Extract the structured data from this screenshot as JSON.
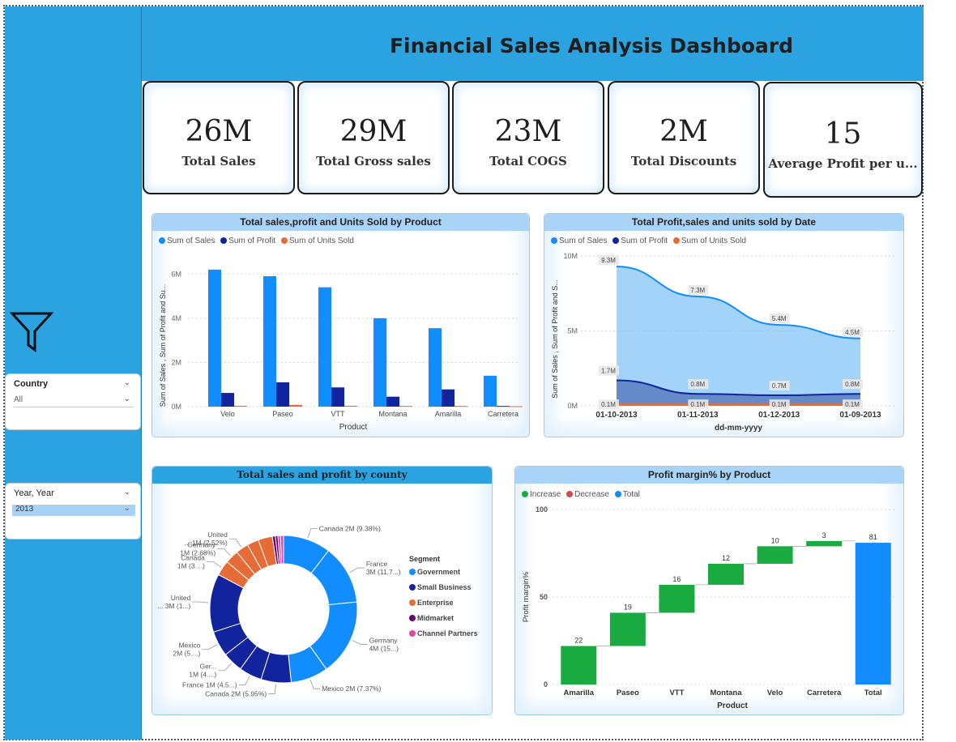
{
  "header": {
    "title": "Financial Sales Analysis Dashboard"
  },
  "filters": {
    "country": {
      "label": "Country",
      "value": "All"
    },
    "year": {
      "label": "Year, Year",
      "value": "2013"
    }
  },
  "kpis": [
    {
      "value": "26M",
      "label": "Total Sales"
    },
    {
      "value": "29M",
      "label": "Total Gross sales"
    },
    {
      "value": "23M",
      "label": "Total COGS"
    },
    {
      "value": "2M",
      "label": "Total Discounts"
    },
    {
      "value": "15",
      "label": "Average Profit per u..."
    }
  ],
  "colors": {
    "sales": "#118DFF",
    "profit": "#12239E",
    "units": "#E66C37",
    "midmarket": "#6B007B",
    "channel": "#E044A7",
    "increase": "#1AAB40",
    "decrease": "#D64550",
    "total": "#118DFF"
  },
  "chart_data": [
    {
      "type": "bar",
      "title": "Total sales,profit and Units Sold by Product",
      "xlabel": "Product",
      "ylabel": "Sum of Sales , Sum of Profit and Su...",
      "legend": [
        "Sum of   Sales",
        "Sum of  Profit",
        "Sum of Units Sold"
      ],
      "categories": [
        "Velo",
        "Paseo",
        "VTT",
        "Montana",
        "Amarilla",
        "Carretera"
      ],
      "series": [
        {
          "name": "Sum of   Sales",
          "values": [
            6.2,
            5.9,
            5.4,
            4.0,
            3.55,
            1.4
          ]
        },
        {
          "name": "Sum of  Profit",
          "values": [
            0.62,
            1.1,
            0.87,
            0.45,
            0.78,
            0.03
          ]
        },
        {
          "name": "Sum of Units Sold",
          "values": [
            0.04,
            0.08,
            0.04,
            0.03,
            0.03,
            0.02
          ]
        }
      ],
      "yticks": [
        "0M",
        "2M",
        "4M",
        "6M"
      ],
      "ylim": [
        0,
        7
      ]
    },
    {
      "type": "area",
      "title": "Total Profit,sales and units sold by Date",
      "xlabel": "dd-mm-yyyy",
      "ylabel": "Sum of Sales , Sum of Profit and S...",
      "legend": [
        "Sum of   Sales",
        "Sum of  Profit",
        "Sum of Units Sold"
      ],
      "x": [
        "01-10-2013",
        "01-11-2013",
        "01-12-2013",
        "01-09-2013"
      ],
      "series": [
        {
          "name": "Sum of   Sales",
          "values": [
            9.3,
            7.3,
            5.4,
            4.5
          ],
          "labels": [
            "9.3M",
            "7.3M",
            "5.4M",
            "4.5M"
          ]
        },
        {
          "name": "Sum of  Profit",
          "values": [
            1.7,
            0.8,
            0.7,
            0.8
          ],
          "labels": [
            "1.7M",
            "0.8M",
            "0.7M",
            "0.8M"
          ]
        },
        {
          "name": "Sum of Units Sold",
          "values": [
            0.1,
            0.1,
            0.1,
            0.1
          ],
          "labels": [
            "0.1M",
            "0.1M",
            "0.1M",
            "0.1M"
          ]
        }
      ],
      "yticks": [
        "0M",
        "5M",
        "10M"
      ],
      "ylim": [
        0,
        10
      ]
    },
    {
      "type": "pie",
      "title": "Total sales and profit by county",
      "legend_title": "Segment",
      "legend": [
        "Government",
        "Small Business",
        "Enterprise",
        "Midmarket",
        "Channel Partners"
      ],
      "slices": [
        {
          "segment": "Government",
          "value": 9.38,
          "label": "Canada 2M (9.38%)"
        },
        {
          "segment": "Government",
          "value": 11.7,
          "label": "France 3M (11.7...)"
        },
        {
          "segment": "Government",
          "value": 15.0,
          "label": "Germany 4M (15...)"
        },
        {
          "segment": "Government",
          "value": 7.37,
          "label": "Mexico 2M (7.37%)"
        },
        {
          "segment": "Small Business",
          "value": 5.95,
          "label": "Canada 2M (5.95%)"
        },
        {
          "segment": "Small Business",
          "value": 4.5,
          "label": "France 1M (4.5...)"
        },
        {
          "segment": "Small Business",
          "value": 4.0,
          "label": "Ger... 1M (4....)"
        },
        {
          "segment": "Small Business",
          "value": 5.0,
          "label": "Mexico 2M (5....)"
        },
        {
          "segment": "Small Business",
          "value": 11.5,
          "label": "United ... 3M (1...)"
        },
        {
          "segment": "Enterprise",
          "value": 3.0,
          "label": "Canada 1M (3....)"
        },
        {
          "segment": "Enterprise",
          "value": 2.68,
          "label": "Germany 1M (2.68%)"
        },
        {
          "segment": "Enterprise",
          "value": 2.52,
          "label": "United ... 1M (2.52%)"
        },
        {
          "segment": "Enterprise",
          "value": 2.3,
          "label": ""
        },
        {
          "segment": "Enterprise",
          "value": 2.8,
          "label": ""
        },
        {
          "segment": "Midmarket",
          "value": 0.6,
          "label": ""
        },
        {
          "segment": "Midmarket",
          "value": 0.5,
          "label": ""
        },
        {
          "segment": "Channel Partners",
          "value": 0.5,
          "label": ""
        },
        {
          "segment": "Channel Partners",
          "value": 0.6,
          "label": ""
        }
      ]
    },
    {
      "type": "bar",
      "title": "Profit margin% by Product",
      "xlabel": "Product",
      "ylabel": "Profit margin%",
      "legend": [
        "Increase",
        "Decrease",
        "Total"
      ],
      "categories": [
        "Amarilla",
        "Paseo",
        "VTT",
        "Montana",
        "Velo",
        "Carretera",
        "Total"
      ],
      "values": [
        22,
        19,
        16,
        12,
        10,
        3,
        81
      ],
      "yticks": [
        "0",
        "50",
        "100"
      ],
      "ylim": [
        0,
        100
      ]
    }
  ]
}
